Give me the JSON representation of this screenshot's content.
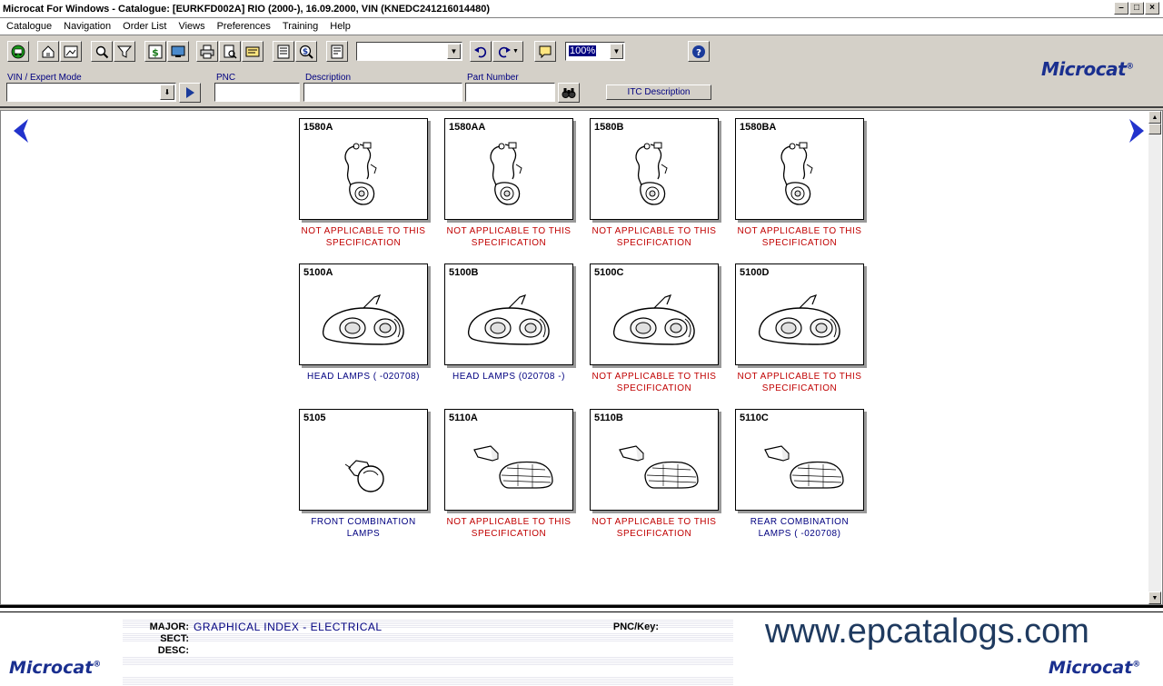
{
  "window": {
    "title": "Microcat For Windows - Catalogue: [EURKFD002A] RIO (2000-), 16.09.2000, VIN (KNEDC241216014480)"
  },
  "menu": [
    "Catalogue",
    "Navigation",
    "Order List",
    "Views",
    "Preferences",
    "Training",
    "Help"
  ],
  "toolbar": {
    "zoom_value": "100%",
    "vin_label": "VIN / Expert Mode",
    "pnc_label": "PNC",
    "description_label": "Description",
    "part_number_label": "Part Number",
    "itc_button": "ITC Description"
  },
  "brand": {
    "logo": "Microcat",
    "reg": "®"
  },
  "tiles": [
    {
      "code": "1580A",
      "caption1": "NOT APPLICABLE TO THIS",
      "caption2": "SPECIFICATION",
      "status": "na",
      "icon": "wiring-harness-icon"
    },
    {
      "code": "1580AA",
      "caption1": "NOT APPLICABLE TO THIS",
      "caption2": "SPECIFICATION",
      "status": "na",
      "icon": "wiring-harness-icon"
    },
    {
      "code": "1580B",
      "caption1": "NOT APPLICABLE TO THIS",
      "caption2": "SPECIFICATION",
      "status": "na",
      "icon": "wiring-harness-icon"
    },
    {
      "code": "1580BA",
      "caption1": "NOT APPLICABLE TO THIS",
      "caption2": "SPECIFICATION",
      "status": "na",
      "icon": "wiring-harness-icon"
    },
    {
      "code": "5100A",
      "caption1": "HEAD LAMPS ( -020708)",
      "caption2": "",
      "status": "ok",
      "icon": "head-lamp-icon"
    },
    {
      "code": "5100B",
      "caption1": "HEAD LAMPS (020708 -)",
      "caption2": "",
      "status": "ok",
      "icon": "head-lamp-icon"
    },
    {
      "code": "5100C",
      "caption1": "NOT APPLICABLE TO THIS",
      "caption2": "SPECIFICATION",
      "status": "na",
      "icon": "head-lamp-icon"
    },
    {
      "code": "5100D",
      "caption1": "NOT APPLICABLE TO THIS",
      "caption2": "SPECIFICATION",
      "status": "na",
      "icon": "head-lamp-icon"
    },
    {
      "code": "5105",
      "caption1": "FRONT COMBINATION",
      "caption2": "LAMPS",
      "status": "ok",
      "icon": "bulb-icon"
    },
    {
      "code": "5110A",
      "caption1": "NOT APPLICABLE TO THIS",
      "caption2": "SPECIFICATION",
      "status": "na",
      "icon": "rear-lamp-icon"
    },
    {
      "code": "5110B",
      "caption1": "NOT APPLICABLE TO THIS",
      "caption2": "SPECIFICATION",
      "status": "na",
      "icon": "rear-lamp-icon"
    },
    {
      "code": "5110C",
      "caption1": "REAR COMBINATION",
      "caption2": "LAMPS ( -020708)",
      "status": "ok",
      "icon": "rear-lamp-icon"
    }
  ],
  "status_panel": {
    "major_label": "MAJOR:",
    "major_value": "GRAPHICAL INDEX - ELECTRICAL",
    "sect_label": "SECT:",
    "desc_label": "DESC:",
    "pnc_key_label": "PNC/Key:",
    "watermark": "www.epcatalogs.com"
  }
}
